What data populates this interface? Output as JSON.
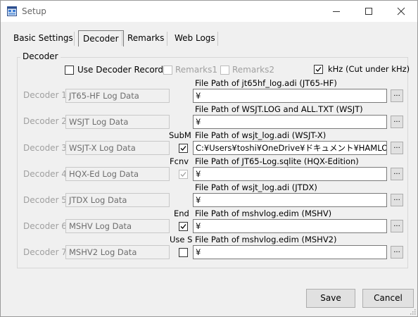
{
  "window": {
    "title": "Setup"
  },
  "tabs": [
    "Basic Settings",
    "Decoder",
    "Remarks",
    "Web Logs"
  ],
  "decoder_group": {
    "title": "Decoder",
    "use_decoder_record": {
      "label": "Use Decoder Record",
      "checked": false
    },
    "remarks1": {
      "label": "Remarks1",
      "checked": false,
      "enabled": false
    },
    "remarks2": {
      "label": "Remarks2",
      "checked": false,
      "enabled": false
    },
    "khz": {
      "label": "kHz (Cut under kHz)",
      "checked": true
    }
  },
  "decoders": [
    {
      "label": "Decoder 1",
      "name": "JT65-HF Log Data",
      "path_label": "File Path of jt65hf_log.adi (JT65-HF)",
      "path": "¥",
      "side_label": "",
      "has_check": false,
      "checked": false,
      "check_enabled": true
    },
    {
      "label": "Decoder 2",
      "name": "WSJT Log Data",
      "path_label": "File Path of WSJT.LOG and ALL.TXT (WSJT)",
      "path": "¥",
      "side_label": "",
      "has_check": false,
      "checked": false,
      "check_enabled": true
    },
    {
      "label": "Decoder 3",
      "name": "WSJT-X Log Data",
      "path_label": "File Path of wsjt_log.adi (WSJT-X)",
      "path": "C:¥Users¥toshi¥OneDrive¥ドキュメント¥HAMLOG",
      "side_label": "SubM",
      "has_check": true,
      "checked": true,
      "check_enabled": true
    },
    {
      "label": "Decoder 4",
      "name": "HQX-Ed Log Data",
      "path_label": "File Path of JT65-Log.sqlite (HQX-Edition)",
      "path": "¥",
      "side_label": "Fcnv",
      "has_check": true,
      "checked": true,
      "check_enabled": false
    },
    {
      "label": "Decoder 5",
      "name": "JTDX Log Data",
      "path_label": "File Path of wsjt_log.adi (JTDX)",
      "path": "¥",
      "side_label": "",
      "has_check": false,
      "checked": false,
      "check_enabled": true
    },
    {
      "label": "Decoder 6",
      "name": "MSHV Log Data",
      "path_label": "File Path of mshvlog.edim (MSHV)",
      "path": "¥",
      "side_label": "End",
      "has_check": true,
      "checked": true,
      "check_enabled": true
    },
    {
      "label": "Decoder 7",
      "name": "MSHV2 Log Data",
      "path_label": "File Path of mshvlog.edim (MSHV2)",
      "path": "¥",
      "side_label": "Use S",
      "has_check": true,
      "checked": false,
      "check_enabled": true
    }
  ],
  "browse_label": "...",
  "buttons": {
    "save": "Save",
    "cancel": "Cancel"
  }
}
